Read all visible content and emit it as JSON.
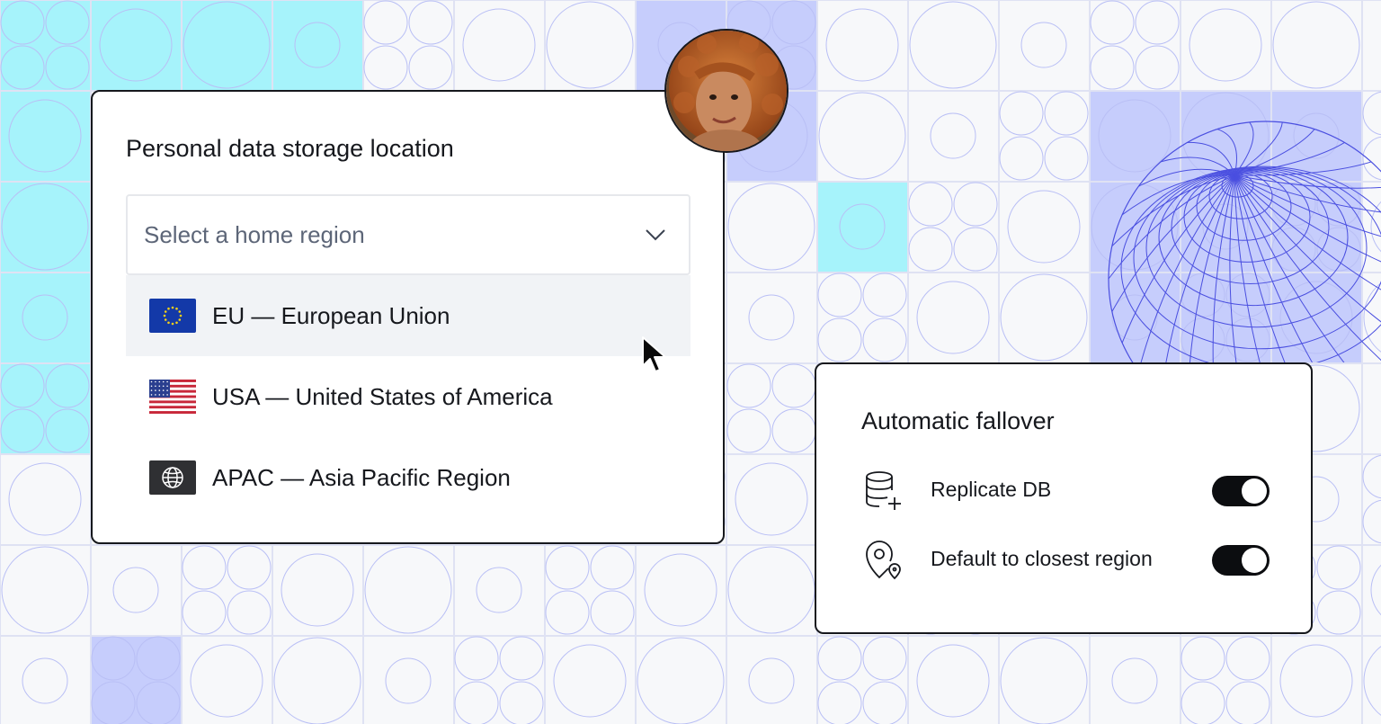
{
  "colors": {
    "cyan": "#a6f3fb",
    "periwinkle": "#c6cdfc",
    "line": "#b9bff5",
    "card_border": "#16181d",
    "option_highlight": "#f1f3f6",
    "toggle_on": "#0c0d10"
  },
  "region_card": {
    "title": "Personal data storage location",
    "select": {
      "placeholder": "Select a home region",
      "icon": "chevron-down-icon"
    },
    "options": [
      {
        "label": "EU — European Union",
        "icon": "eu-flag-icon",
        "highlighted": true
      },
      {
        "label": "USA — United States of America",
        "icon": "us-flag-icon",
        "highlighted": false
      },
      {
        "label": "APAC — Asia Pacific Region",
        "icon": "globe-icon",
        "highlighted": false
      }
    ]
  },
  "fallover_card": {
    "title": "Automatic fallover",
    "rows": [
      {
        "label": "Replicate DB",
        "icon": "database-add-icon",
        "enabled": true
      },
      {
        "label": "Default to closest region",
        "icon": "location-pin-icon",
        "enabled": true
      }
    ]
  },
  "decorations": {
    "avatar": "user-avatar",
    "cursor": "mouse-pointer-icon",
    "globe": "wireframe-globe-illustration"
  }
}
